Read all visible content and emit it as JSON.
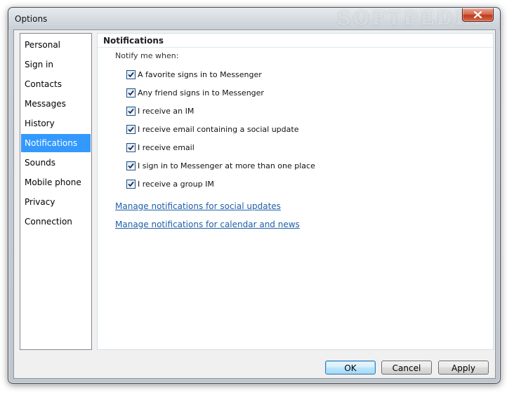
{
  "window": {
    "title": "Options",
    "watermark": "SOFTPEDIA"
  },
  "sidebar": {
    "items": [
      {
        "label": "Personal",
        "selected": false
      },
      {
        "label": "Sign in",
        "selected": false
      },
      {
        "label": "Contacts",
        "selected": false
      },
      {
        "label": "Messages",
        "selected": false
      },
      {
        "label": "History",
        "selected": false
      },
      {
        "label": "Notifications",
        "selected": true
      },
      {
        "label": "Sounds",
        "selected": false
      },
      {
        "label": "Mobile phone",
        "selected": false
      },
      {
        "label": "Privacy",
        "selected": false
      },
      {
        "label": "Connection",
        "selected": false
      }
    ],
    "selected_color": "#3399ff"
  },
  "content": {
    "section_title": "Notifications",
    "notify_label": "Notify me when:",
    "options": [
      {
        "label": "A favorite signs in to Messenger",
        "checked": true
      },
      {
        "label": "Any friend signs in to Messenger",
        "checked": true
      },
      {
        "label": "I receive an IM",
        "checked": true
      },
      {
        "label": "I receive email containing a social update",
        "checked": true
      },
      {
        "label": "I receive email",
        "checked": true
      },
      {
        "label": "I sign in to Messenger at more than one place",
        "checked": true
      },
      {
        "label": "I receive a group IM",
        "checked": true
      }
    ],
    "links": [
      {
        "label": "Manage notifications for social updates"
      },
      {
        "label": "Manage notifications for calendar and news"
      }
    ]
  },
  "buttons": {
    "ok": "OK",
    "cancel": "Cancel",
    "apply": "Apply"
  },
  "icons": {
    "close": "close-icon",
    "check": "checkmark-icon"
  }
}
